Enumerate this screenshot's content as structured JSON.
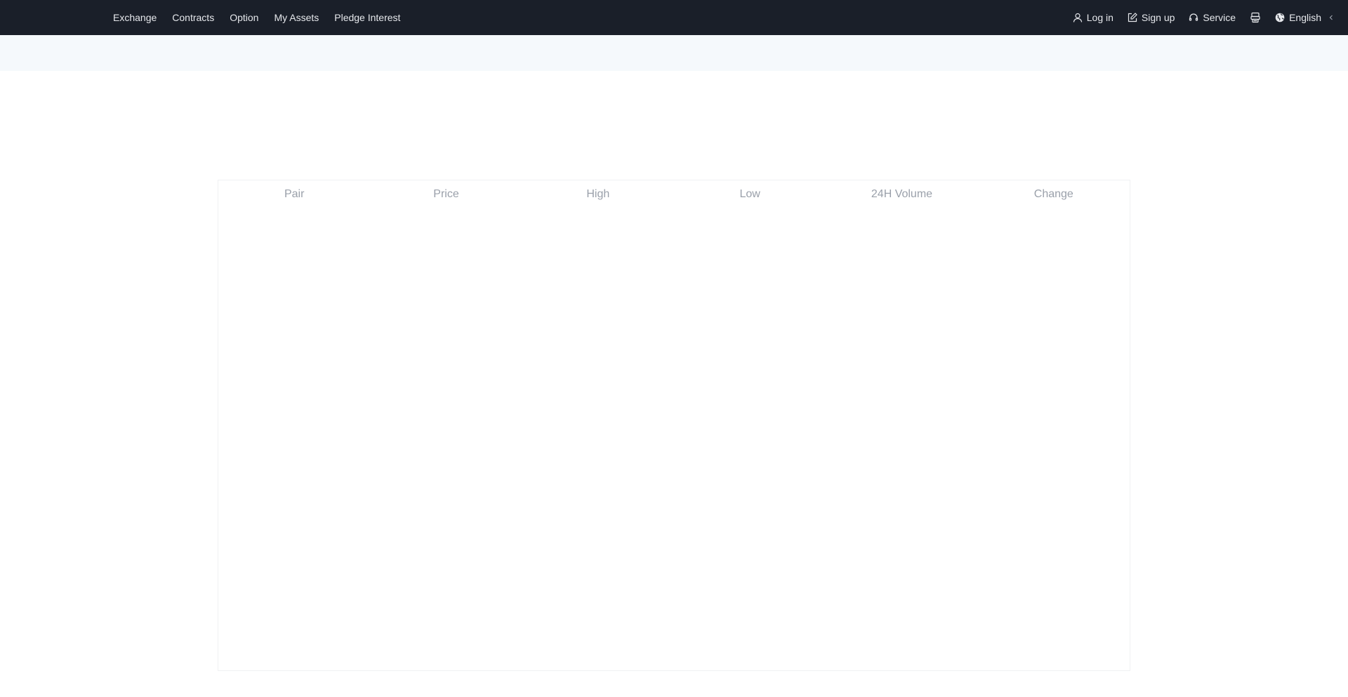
{
  "nav": {
    "items": [
      {
        "label": "Exchange"
      },
      {
        "label": "Contracts"
      },
      {
        "label": "Option"
      },
      {
        "label": "My Assets"
      },
      {
        "label": "Pledge Interest"
      }
    ],
    "login_label": "Log in",
    "signup_label": "Sign up",
    "service_label": "Service",
    "language_label": "English"
  },
  "icons": {
    "login": "user-icon",
    "signup": "edit-icon",
    "service": "headset-icon",
    "download": "download-app-icon",
    "language": "globe-icon",
    "chevron": "chevron-left-icon"
  },
  "colors": {
    "topbar_bg": "#1a1f29",
    "banner_bg": "#f5f9fc",
    "header_text": "#9aa0aa"
  },
  "market": {
    "columns": [
      "Pair",
      "Price",
      "High",
      "Low",
      "24H Volume",
      "Change"
    ]
  }
}
